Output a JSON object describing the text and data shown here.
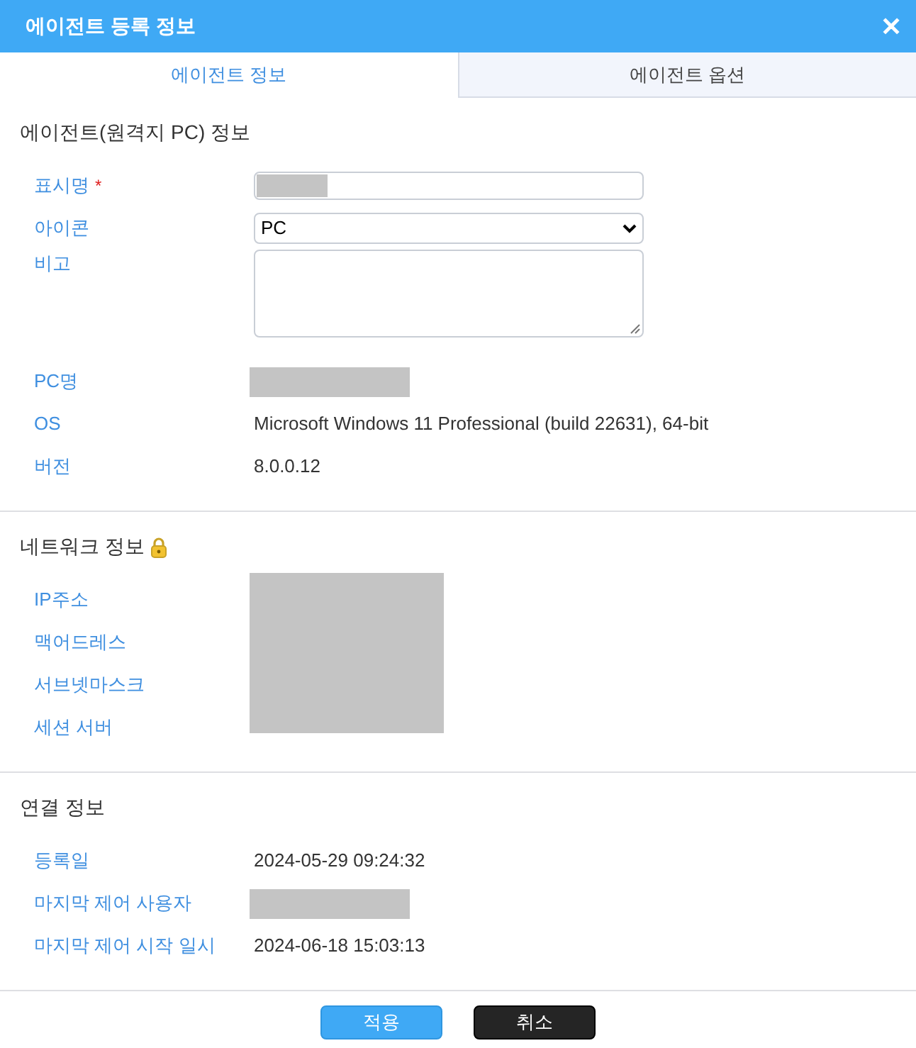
{
  "window": {
    "title": "에이전트 등록 정보",
    "close": "✕"
  },
  "tabs": [
    {
      "label": "에이전트 정보",
      "selected": true
    },
    {
      "label": "에이전트 옵션",
      "selected": false
    }
  ],
  "sections": [
    {
      "title": "에이전트(원격지 PC) 정보",
      "kind": "plain",
      "rows": [
        {
          "label": "표시명",
          "required_mark": "*",
          "kind": "input"
        },
        {
          "label": "아이콘",
          "kind": "select",
          "value": "PC"
        },
        {
          "label": "비고",
          "kind": "textarea"
        },
        {
          "label": "PC명",
          "kind": "redacted"
        },
        {
          "label": "OS",
          "kind": "text",
          "value": "Microsoft Windows 11 Professional (build 22631), 64-bit"
        },
        {
          "label": "버전",
          "kind": "text",
          "value": "8.0.0.12"
        }
      ]
    },
    {
      "title": "네트워크 정보",
      "kind": "locked",
      "rows": [
        {
          "label": "IP주소",
          "kind": "none"
        },
        {
          "label": "맥어드레스",
          "kind": "none"
        },
        {
          "label": "서브넷마스크",
          "kind": "none"
        },
        {
          "label": "세션 서버",
          "kind": "none"
        }
      ]
    },
    {
      "title": "연결 정보",
      "kind": "plain",
      "rows": [
        {
          "label": "등록일",
          "kind": "text",
          "value": "2024-05-29 09:24:32"
        },
        {
          "label": "마지막 제어 사용자",
          "kind": "redacted"
        },
        {
          "label": "마지막 제어 시작 일시",
          "kind": "text",
          "value": "2024-06-18 15:03:13"
        }
      ]
    }
  ],
  "buttons": [
    {
      "label": "적용",
      "kind": "primary"
    },
    {
      "label": "취소",
      "kind": "dark"
    }
  ]
}
